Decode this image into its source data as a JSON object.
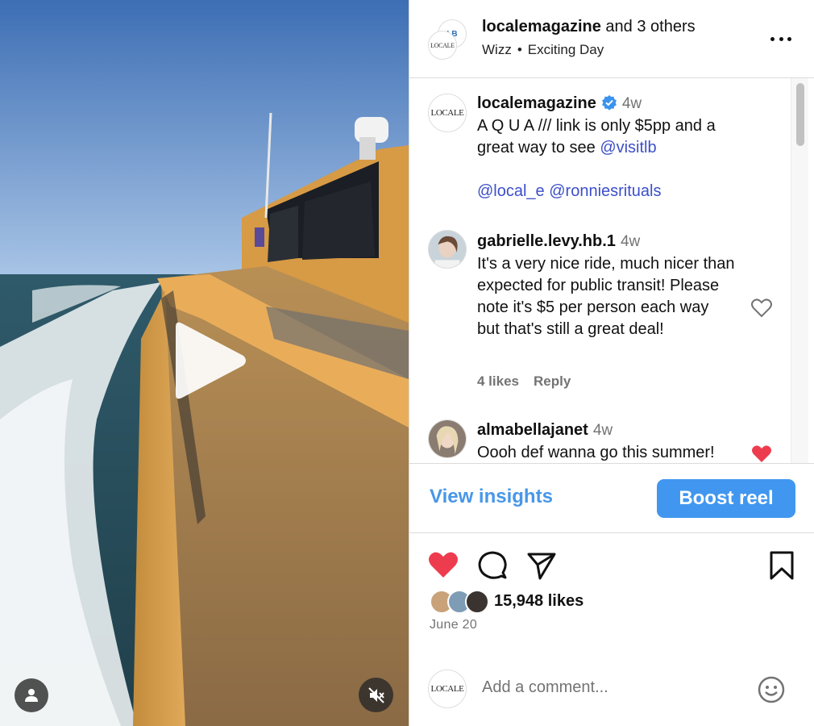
{
  "header": {
    "account": "localemagazine",
    "and_others": "and 3 others",
    "subtitle_left": "Wizz",
    "subtitle_sep": "•",
    "subtitle_right": "Exciting Day",
    "avatar_back_text": "LB",
    "avatar_front_text": "LOCALE"
  },
  "caption": {
    "avatar_text": "LOCALE",
    "username": "localemagazine",
    "time": "4w",
    "text": "A Q U A /// link is only $5pp and a great way to see ",
    "mention_visitlb": "@visitlb",
    "mention_local_e": "@local_e",
    "mention_ronnies": "@ronniesrituals"
  },
  "comments": [
    {
      "username": "gabrielle.levy.hb.1",
      "time": "4w",
      "text": "It's a very nice ride, much nicer than expected for public transit! Please note it's $5 per person each way but that's still a great deal!",
      "likes": "4 likes",
      "reply": "Reply",
      "liked": false
    },
    {
      "username": "almabellajanet",
      "time": "4w",
      "text": "Oooh def wanna go this summer!",
      "liked": true
    }
  ],
  "insights": {
    "view_label": "View insights",
    "boost_label": "Boost reel"
  },
  "stats": {
    "likes": "15,948 likes",
    "date": "June 20"
  },
  "comment_box": {
    "avatar_text": "LOCALE",
    "placeholder": "Add a comment..."
  },
  "colors": {
    "accent": "#4197ef",
    "link": "#4897e8",
    "mention": "#3c4fc9",
    "like_red": "#ee3c4f",
    "muted": "#737373"
  },
  "icons": [
    "play-icon",
    "user-tag-icon",
    "muted-icon",
    "more-icon",
    "verified-icon",
    "heart-icon",
    "comment-icon",
    "share-icon",
    "bookmark-icon",
    "emoji-icon"
  ]
}
